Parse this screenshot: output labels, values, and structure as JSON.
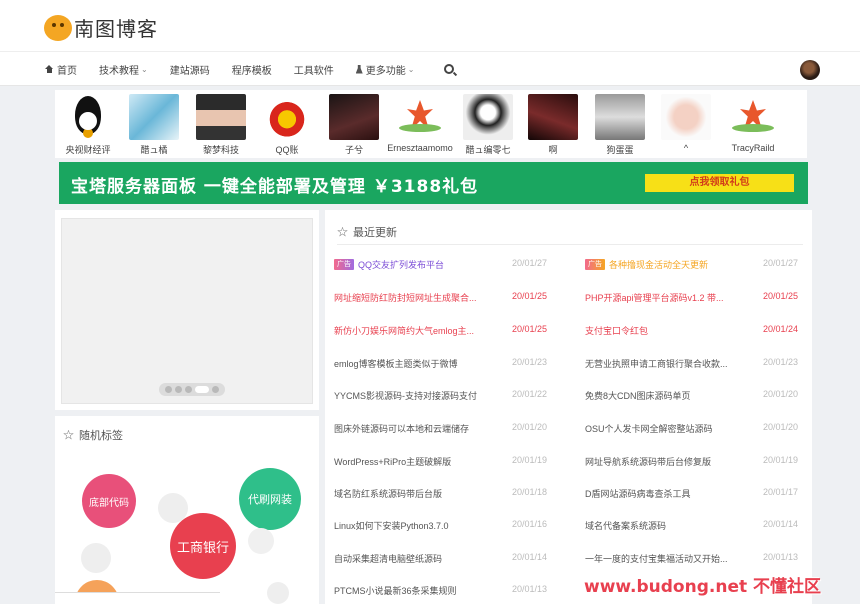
{
  "site": {
    "title": "南图博客"
  },
  "nav": {
    "items": [
      {
        "label": "首页",
        "icon": "home-icon",
        "dropdown": false
      },
      {
        "label": "技术教程",
        "dropdown": true
      },
      {
        "label": "建站源码",
        "dropdown": false
      },
      {
        "label": "程序模板",
        "dropdown": false
      },
      {
        "label": "工具软件",
        "dropdown": false
      },
      {
        "label": "更多功能",
        "icon": "flask-icon",
        "dropdown": true
      }
    ],
    "caret": "⌄"
  },
  "friends": [
    {
      "name": "央视财经评",
      "pic": "qq"
    },
    {
      "name": "醋ュ橘",
      "pic": "anime1"
    },
    {
      "name": "黎梦科技",
      "pic": "person"
    },
    {
      "name": "QQ账",
      "pic": "qqr"
    },
    {
      "name": "子兮",
      "pic": "dark1"
    },
    {
      "name": "Ernesztaamomo",
      "pic": "flower"
    },
    {
      "name": "醋ュ编零七",
      "pic": "anime2"
    },
    {
      "name": "啊",
      "pic": "dark2"
    },
    {
      "name": "狗蛋蛋",
      "pic": "gray"
    },
    {
      "name": "^",
      "pic": "baby"
    },
    {
      "name": "TracyRaild",
      "pic": "flower"
    }
  ],
  "ad": {
    "text": "宝塔服务器面板 一键全能部署及管理 ￥3188礼包",
    "button": "点我领取礼包",
    "bg": "#1aa660",
    "button_bg": "#f7e017"
  },
  "slider": {
    "dots": 5,
    "active_index": 3
  },
  "tags": {
    "title": "随机标签",
    "bubbles": [
      {
        "text": "底部代码",
        "color": "#e8507a"
      },
      {
        "text": "代刷网装",
        "color": "#2fbf8a"
      },
      {
        "text": "工商银行",
        "color": "#e8404f"
      },
      {
        "text": "",
        "color": "#eeeeee"
      },
      {
        "text": "",
        "color": "#eeeeee"
      },
      {
        "text": "",
        "color": "#f0f0f0"
      },
      {
        "text": "",
        "color": "#eeeeee"
      },
      {
        "text": "",
        "color": "#f5a25a"
      },
      {
        "text": "",
        "color": "#4a90e2"
      }
    ]
  },
  "recent": {
    "title": "最近更新",
    "left": [
      {
        "badge": "广告",
        "badge_style": "purple",
        "title": "QQ交友扩列发布平台",
        "date": "20/01/27",
        "color": "#7a4bd6",
        "date_color": "#bbbbbb"
      },
      {
        "title": "网址缩短防红防封短网址生成聚合...",
        "date": "20/01/25",
        "color": "#e8404f",
        "date_color": "#e8404f"
      },
      {
        "title": "新仿小刀娱乐网简约大气emlog主...",
        "date": "20/01/25",
        "color": "#e8404f",
        "date_color": "#e8404f"
      },
      {
        "title": "emlog博客模板主题类似于微博",
        "date": "20/01/23",
        "color": "#555555",
        "date_color": "#bbbbbb"
      },
      {
        "title": "YYCMS影视源码-支持对接源码支付",
        "date": "20/01/22",
        "color": "#555555",
        "date_color": "#bbbbbb"
      },
      {
        "title": "图床外链源码可以本地和云端储存",
        "date": "20/01/20",
        "color": "#555555",
        "date_color": "#bbbbbb"
      },
      {
        "title": "WordPress+RiPro主题破解版",
        "date": "20/01/19",
        "color": "#555555",
        "date_color": "#bbbbbb"
      },
      {
        "title": "域名防红系统源码带后台版",
        "date": "20/01/18",
        "color": "#555555",
        "date_color": "#bbbbbb"
      },
      {
        "title": "Linux如何下安装Python3.7.0",
        "date": "20/01/16",
        "color": "#555555",
        "date_color": "#bbbbbb"
      },
      {
        "title": "自动采集超清电脑壁纸源码",
        "date": "20/01/14",
        "color": "#555555",
        "date_color": "#bbbbbb"
      },
      {
        "title": "PTCMS小说最新36条采集规则",
        "date": "20/01/13",
        "color": "#555555",
        "date_color": "#bbbbbb"
      }
    ],
    "right": [
      {
        "badge": "广告",
        "badge_style": "orange",
        "title": "各种撸现金活动全天更新",
        "date": "20/01/27",
        "color": "#f5a623",
        "date_color": "#bbbbbb"
      },
      {
        "title": "PHP开源api管理平台源码v1.2 带...",
        "date": "20/01/25",
        "color": "#e8404f",
        "date_color": "#e8404f"
      },
      {
        "title": "支付宝口令红包",
        "date": "20/01/24",
        "color": "#e8404f",
        "date_color": "#e8404f"
      },
      {
        "title": "无营业执照申请工商银行聚合收款...",
        "date": "20/01/23",
        "color": "#555555",
        "date_color": "#bbbbbb"
      },
      {
        "title": "免费8大CDN图床源码单页",
        "date": "20/01/20",
        "color": "#555555",
        "date_color": "#bbbbbb"
      },
      {
        "title": "OSU个人发卡网全解密整站源码",
        "date": "20/01/20",
        "color": "#555555",
        "date_color": "#bbbbbb"
      },
      {
        "title": "网址导航系统源码带后台修复版",
        "date": "20/01/19",
        "color": "#555555",
        "date_color": "#bbbbbb"
      },
      {
        "title": "D盾网站源码病毒查杀工具",
        "date": "20/01/17",
        "color": "#555555",
        "date_color": "#bbbbbb"
      },
      {
        "title": "域名代备案系统源码",
        "date": "20/01/14",
        "color": "#555555",
        "date_color": "#bbbbbb"
      },
      {
        "title": "一年一度的支付宝集福活动又开始...",
        "date": "20/01/13",
        "color": "#555555",
        "date_color": "#bbbbbb"
      },
      {
        "title": "",
        "date": "",
        "color": "#555555",
        "date_color": "#bbbbbb"
      }
    ]
  },
  "watermark": "www.budong.net 不懂社区"
}
